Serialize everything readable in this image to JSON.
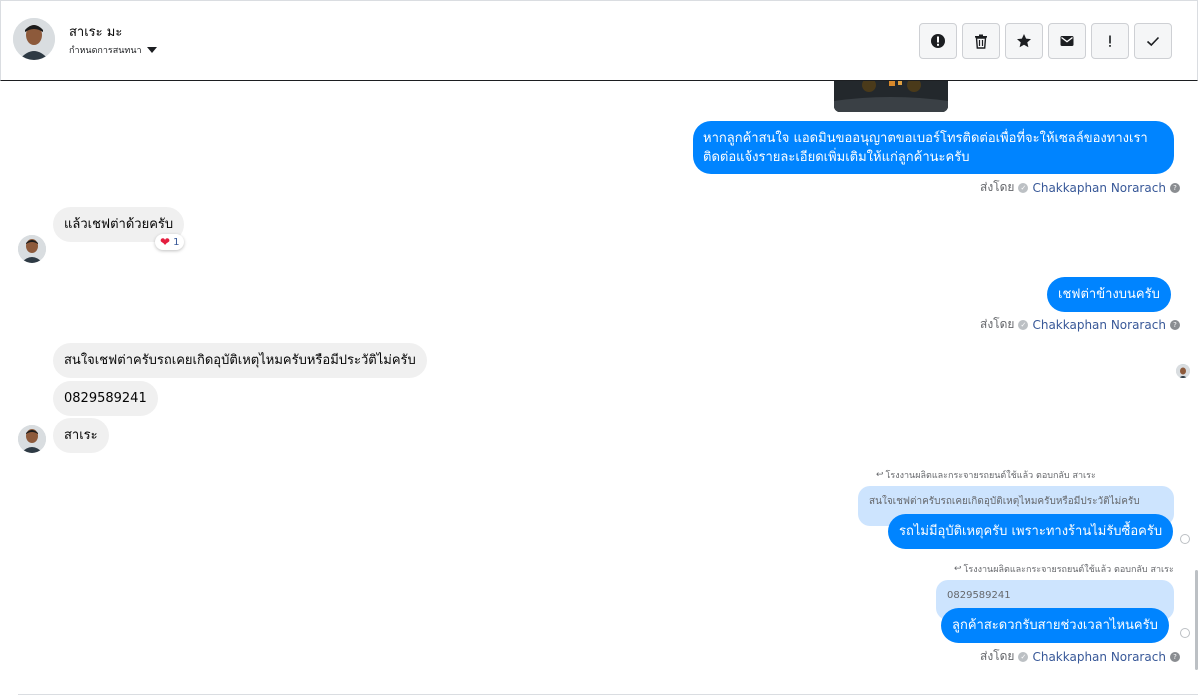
{
  "header": {
    "contact_name": "สาเระ มะ",
    "assign_label": "กำหนดการสนทนา",
    "toolbar": [
      {
        "name": "report-spam-button",
        "icon": "alert-circle-icon"
      },
      {
        "name": "delete-button",
        "icon": "trash-icon"
      },
      {
        "name": "star-button",
        "icon": "star-icon"
      },
      {
        "name": "mark-unread-button",
        "icon": "envelope-icon"
      },
      {
        "name": "important-button",
        "icon": "exclamation-icon"
      },
      {
        "name": "mark-done-button",
        "icon": "check-icon"
      }
    ]
  },
  "messages": {
    "out1": "หากลูกค้าสนใจ แอดมินขออนุญาตขอเบอร์โทรติดต่อเพื่อที่จะให้เซลล์ของทางเรา",
    "out1b": "ติดต่อแจ้งรายละเอียดเพิ่มเติมให้แก่ลูกค้านะครับ",
    "in1": "แล้วเชฟต่าด้วยครับ",
    "in1_reaction_count": "1",
    "out2": "เชฟต่าข้างบนครับ",
    "in2": "สนใจเชฟต่าครับรถเคยเกิดอุบัติเหตุไหมครับหรือมีประวัติไม่ครับ",
    "in3": "0829589241",
    "in4": "สาเระ",
    "reply1_note": "โรงงานผลิตและกระจายรถยนต์ใช้แล้ว ตอบกลับ สาเระ",
    "reply1_quote": "สนใจเชฟต่าครับรถเคยเกิดอุบัติเหตุไหมครับหรือมีประวัติไม่ครับ",
    "reply1_text": "รถไม่มีอุบัติเหตุครับ เพราะทางร้านไม่รับซื้อครับ",
    "reply2_note": "โรงงานผลิตและกระจายรถยนต์ใช้แล้ว ตอบกลับ สาเระ",
    "reply2_quote": "0829589241",
    "reply2_text": "ลูกค้าสะดวกรับสายช่วงเวลาไหนครับ"
  },
  "sent_by": {
    "label": "ส่งโดย",
    "agent": "Chakkaphan Norarach"
  },
  "colors": {
    "outgoing_bubble": "#0084ff",
    "incoming_bubble": "#f0f0f0",
    "quote_bubble": "#cde4fe",
    "agent_link": "#385898"
  }
}
